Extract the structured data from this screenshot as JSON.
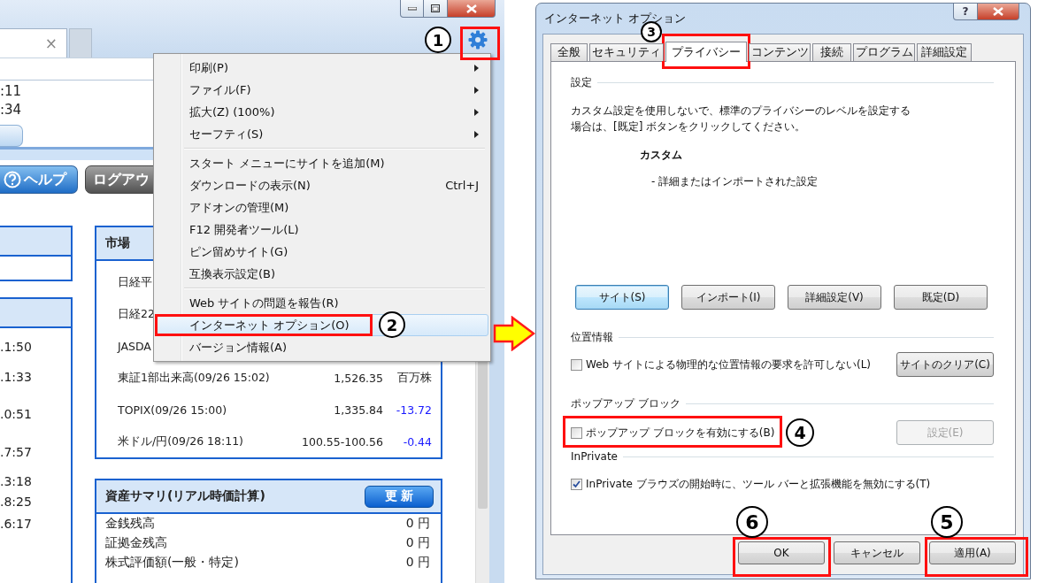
{
  "browser": {
    "tab_close": "×",
    "info_times": [
      ":11",
      ":34"
    ],
    "buttons": [
      {
        "kind": "help",
        "label": "ヘルプ"
      },
      {
        "kind": "logout",
        "label": "ログアウ"
      }
    ],
    "left_times": [
      ".1:50",
      ".1:33",
      ".0:51",
      ".7:57",
      ".3:18",
      ".8:25",
      ".6:17"
    ],
    "market": {
      "title": "市場",
      "rows": [
        {
          "name": "日経平"
        },
        {
          "name": "日経22"
        },
        {
          "name": "JASDA"
        },
        {
          "name": "東証1部出来高(09/26 15:02)",
          "value": "1,526.35",
          "unit": "百万株"
        },
        {
          "name": "TOPIX(09/26 15:00)",
          "value": "1,335.84",
          "change": "-13.72"
        },
        {
          "name": "米ドル/円(09/26 18:11)",
          "value": "100.55-100.56",
          "change": "-0.44"
        }
      ]
    },
    "assets": {
      "title": "資産サマリ(リアル時価計算)",
      "button": "更 新",
      "rows": [
        {
          "name": "金銭残高",
          "value": "0 円"
        },
        {
          "name": "証拠金残高",
          "value": "0 円"
        },
        {
          "name": "株式評価額(一般・特定)",
          "value": "0 円"
        }
      ]
    }
  },
  "menu": {
    "groups": [
      [
        {
          "label": "印刷(P)",
          "submenu": true,
          "selected": false
        },
        {
          "label": "ファイル(F)",
          "submenu": true,
          "selected": false
        },
        {
          "label": "拡大(Z) (100%)",
          "submenu": true,
          "selected": false
        },
        {
          "label": "セーフティ(S)",
          "submenu": true,
          "selected": false
        }
      ],
      [
        {
          "label": "スタート メニューにサイトを追加(M)",
          "submenu": false,
          "selected": false
        },
        {
          "label": "ダウンロードの表示(N)",
          "shortcut": "Ctrl+J",
          "submenu": false,
          "selected": false
        },
        {
          "label": "アドオンの管理(M)",
          "submenu": false,
          "selected": false
        },
        {
          "label": "F12 開発者ツール(L)",
          "submenu": false,
          "selected": false
        },
        {
          "label": "ピン留めサイト(G)",
          "submenu": false,
          "selected": false
        },
        {
          "label": "互換表示設定(B)",
          "submenu": false,
          "selected": false
        }
      ],
      [
        {
          "label": "Web サイトの問題を報告(R)",
          "submenu": false,
          "selected": false
        },
        {
          "label": "インターネット オプション(O)",
          "submenu": false,
          "selected": true
        },
        {
          "label": "バージョン情報(A)",
          "submenu": false,
          "selected": false
        }
      ]
    ]
  },
  "dialog": {
    "title": "インターネット オプション",
    "help": "?",
    "tabs": [
      {
        "label": "全般",
        "selected": false
      },
      {
        "label": "セキュリティ",
        "selected": false
      },
      {
        "label": "プライバシー",
        "selected": true
      },
      {
        "label": "コンテンツ",
        "selected": false
      },
      {
        "label": "接続",
        "selected": false
      },
      {
        "label": "プログラム",
        "selected": false
      },
      {
        "label": "詳細設定",
        "selected": false
      }
    ],
    "settings": {
      "title": "設定",
      "description": "カスタム設定を使用しないで、標準のプライバシーのレベルを設定する場合は、[既定] ボタンをクリックしてください。",
      "level_name": "カスタム",
      "detail": "- 詳細またはインポートされた設定",
      "buttons": [
        {
          "label": "サイト(S)",
          "focused": true
        },
        {
          "label": "インポート(I)",
          "focused": false
        },
        {
          "label": "詳細設定(V)",
          "focused": false
        },
        {
          "label": "既定(D)",
          "focused": false
        }
      ]
    },
    "location": {
      "title": "位置情報",
      "checkbox": {
        "label": "Web サイトによる物理的な位置情報の要求を許可しない(L)",
        "checked": false
      },
      "button": {
        "label": "サイトのクリア(C)",
        "disabled": false
      }
    },
    "popup": {
      "title": "ポップアップ ブロック",
      "checkbox": {
        "label": "ポップアップ ブロックを有効にする(B)",
        "checked": false
      },
      "button": {
        "label": "設定(E)",
        "disabled": true
      }
    },
    "inprivate": {
      "title": "InPrivate",
      "checkbox": {
        "label": "InPrivate ブラウズの開始時に、ツール バーと拡張機能を無効にする(T)",
        "checked": true
      }
    },
    "footer_buttons": [
      {
        "label": "OK"
      },
      {
        "label": "キャンセル"
      },
      {
        "label": "適用(A)"
      }
    ]
  },
  "callouts": [
    {
      "label": "1"
    },
    {
      "label": "2"
    },
    {
      "label": "3"
    },
    {
      "label": "4"
    },
    {
      "label": "5"
    },
    {
      "label": "6"
    }
  ]
}
